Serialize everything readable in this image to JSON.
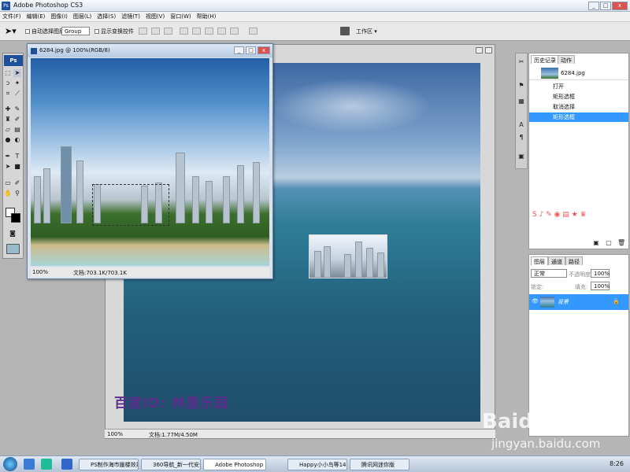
{
  "app": {
    "title": "Adobe Photoshop CS3",
    "ps": "Ps"
  },
  "window_controls": {
    "min": "_",
    "max": "□",
    "close": "x"
  },
  "menu": [
    "文件(F)",
    "编辑(E)",
    "图像(I)",
    "图层(L)",
    "选择(S)",
    "滤镜(T)",
    "视图(V)",
    "窗口(W)",
    "帮助(H)"
  ],
  "options": {
    "auto_select": "自动选择图层",
    "group": "Group",
    "show_transform": "显示变换控件",
    "workspace": "工作区"
  },
  "image_window": {
    "title": "6284.jpg @ 100%(RGB/8)",
    "zoom": "100%",
    "doc": "文档:703.1K/703.1K"
  },
  "canvas": {
    "zoom": "100%",
    "doc": "文档:1.77M/4.50M"
  },
  "history_panel": {
    "tabs": [
      "历史记录",
      "动作"
    ],
    "snapshot": "6284.jpg",
    "items": [
      "打开",
      "矩形选框",
      "取消选择",
      "矩形选框"
    ],
    "selected_index": 3
  },
  "layers_panel": {
    "tabs": [
      "图层",
      "通道",
      "路径"
    ],
    "mode": "正常",
    "opacity_label": "不透明度:",
    "opacity": "100%",
    "lock_label": "锁定:",
    "fill_label": "填充:",
    "fill": "100%",
    "layer": "背景"
  },
  "watermark": "百度ID: 林塁乐园",
  "baidu": {
    "logo": "Baidu经验",
    "url": "jingyan.baidu.com"
  },
  "taskbar": {
    "items": [
      "PS制作海市蜃楼效果...",
      "360导航_新一代安全...",
      "Adobe Photoshop ...",
      "Happy小小鸟等14...",
      "腾讯网迷你版"
    ],
    "active_index": 2,
    "clock": "8:26"
  },
  "colors": {
    "accent": "#3399ff",
    "brand": "#1d4f9c"
  }
}
